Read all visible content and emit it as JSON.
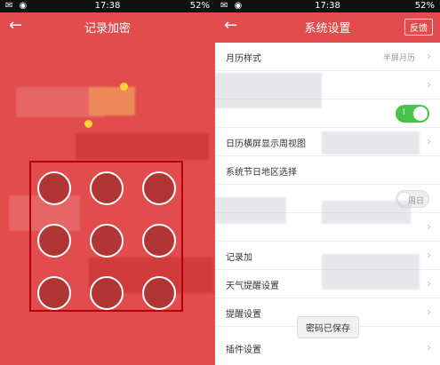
{
  "status_bar": {
    "time": "17:38",
    "battery": "52%"
  },
  "left_screen": {
    "title": "记录加密"
  },
  "right_screen": {
    "title": "系统设置",
    "feedback_label": "反馈",
    "rows": [
      {
        "label": "月历样式",
        "value": "半屏月历"
      },
      {
        "label": "",
        "value": ""
      },
      {
        "label": "",
        "value": ""
      },
      {
        "label": "日历横屏显示周视图",
        "value": ""
      },
      {
        "label": "系统节日地区选择",
        "value": ""
      },
      {
        "label": "",
        "value": ""
      },
      {
        "label": "",
        "value": ""
      },
      {
        "label": "记录加",
        "value": ""
      },
      {
        "label": "天气提醒设置",
        "value": ""
      },
      {
        "label": "提醒设置",
        "value": ""
      },
      {
        "label": "插件设置",
        "value": ""
      }
    ],
    "toggle_on_label": "I",
    "toggle_off_label": "周日",
    "toast": "密码已保存"
  }
}
